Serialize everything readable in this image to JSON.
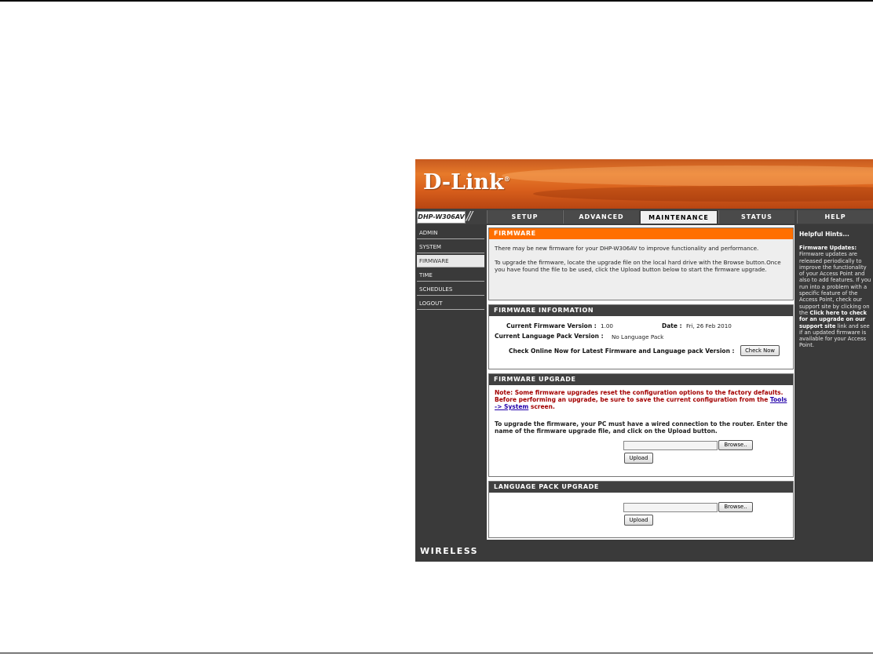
{
  "brand": {
    "logo": "D-Link",
    "reg_mark": "®",
    "model": "DHP-W306AV",
    "model_slash": "//",
    "footer": "WIRELESS"
  },
  "tabs": [
    {
      "label": "SETUP"
    },
    {
      "label": "ADVANCED"
    },
    {
      "label": "MAINTENANCE",
      "active": true
    },
    {
      "label": "STATUS"
    },
    {
      "label": "HELP"
    }
  ],
  "sidebar": {
    "items": [
      {
        "label": "ADMIN"
      },
      {
        "label": "SYSTEM"
      },
      {
        "label": "FIRMWARE",
        "active": true
      },
      {
        "label": "TIME"
      },
      {
        "label": "SCHEDULES"
      },
      {
        "label": "LOGOUT"
      }
    ]
  },
  "firmware": {
    "title": "FIRMWARE",
    "intro1": "There may be new firmware for your DHP-W306AV to improve functionality and performance.",
    "intro2": "To upgrade the firmware, locate the upgrade file on the local hard drive with the Browse button.Once you have found the file to be used, click the Upload button below to start the firmware upgrade."
  },
  "firmware_info": {
    "title": "FIRMWARE INFORMATION",
    "fw_label": "Current Firmware Version :",
    "fw_value": "1.00",
    "date_label": "Date :",
    "date_value": "Fri, 26 Feb 2010",
    "lang_label": "Current Language Pack Version :",
    "lang_value": "No Language Pack",
    "check_label": "Check Online Now for Latest Firmware and Language pack Version  :",
    "check_button": "Check Now"
  },
  "firmware_upgrade": {
    "title": "FIRMWARE UPGRADE",
    "note_pre": "Note: Some firmware upgrades reset the configuration options to the factory defaults. Before performing an upgrade, be sure to save the current configuration from the ",
    "note_link": "Tools -> System",
    "note_post": " screen.",
    "instructions": "To upgrade the firmware, your PC must have a wired connection to the router. Enter the name of the firmware upgrade file, and click on the Upload button.",
    "browse_button": "Browse..",
    "upload_button": "Upload"
  },
  "language_upgrade": {
    "title": "LANGUAGE PACK UPGRADE",
    "browse_button": "Browse..",
    "upload_button": "Upload"
  },
  "help": {
    "title": "Helpful Hints...",
    "heading": "Firmware Updates:",
    "text1": " Firmware updates are released periodically to improve the functionality of your Access Point and also to add features. If you run into a problem with a specific feature of the Access Point, check our support site by clicking on the ",
    "link": "Click here to check for an upgrade on our support site",
    "text2": " link and see if an updated firmware is available for your Access Point."
  }
}
